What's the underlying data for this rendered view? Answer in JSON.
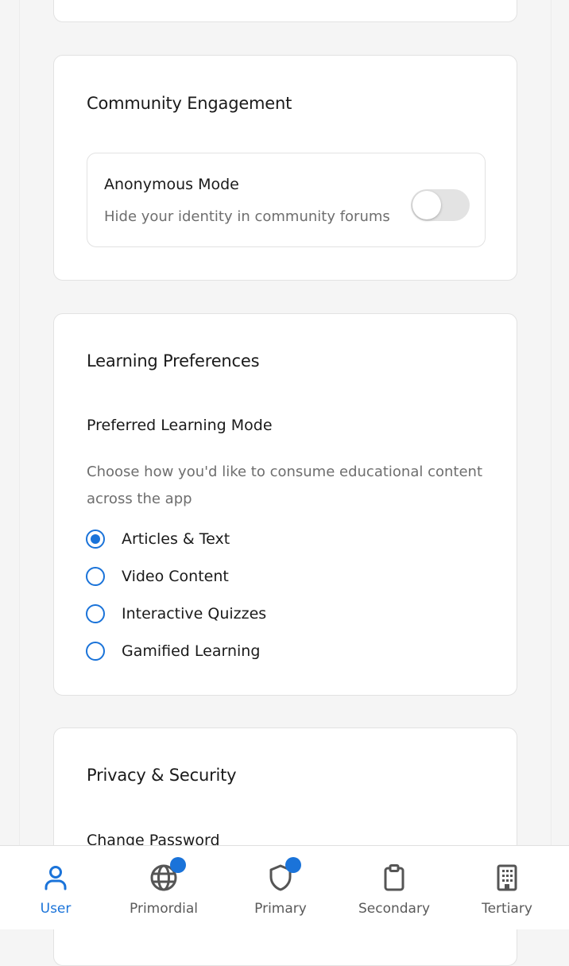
{
  "community": {
    "title": "Community Engagement",
    "anonymous_label": "Anonymous Mode",
    "anonymous_desc": "Hide your identity in community forums",
    "anonymous_enabled": false
  },
  "learning": {
    "title": "Learning Preferences",
    "mode_label": "Preferred Learning Mode",
    "mode_desc": "Choose how you'd like to consume educational content across the app",
    "options": [
      {
        "label": "Articles & Text",
        "selected": true
      },
      {
        "label": "Video Content",
        "selected": false
      },
      {
        "label": "Interactive Quizzes",
        "selected": false
      },
      {
        "label": "Gamified Learning",
        "selected": false
      }
    ]
  },
  "privacy": {
    "title": "Privacy & Security",
    "change_password_label": "Change Password"
  },
  "bottom_nav": {
    "items": [
      {
        "label": "User",
        "icon": "user-icon",
        "active": true,
        "badge": false
      },
      {
        "label": "Primordial",
        "icon": "globe-icon",
        "active": false,
        "badge": true
      },
      {
        "label": "Primary",
        "icon": "shield-icon",
        "active": false,
        "badge": true
      },
      {
        "label": "Secondary",
        "icon": "clipboard-icon",
        "active": false,
        "badge": false
      },
      {
        "label": "Tertiary",
        "icon": "building-icon",
        "active": false,
        "badge": false
      }
    ]
  },
  "colors": {
    "accent": "#1a73d9",
    "toggle_off": "#e3e3e3",
    "muted_text": "#6e6e6e"
  }
}
